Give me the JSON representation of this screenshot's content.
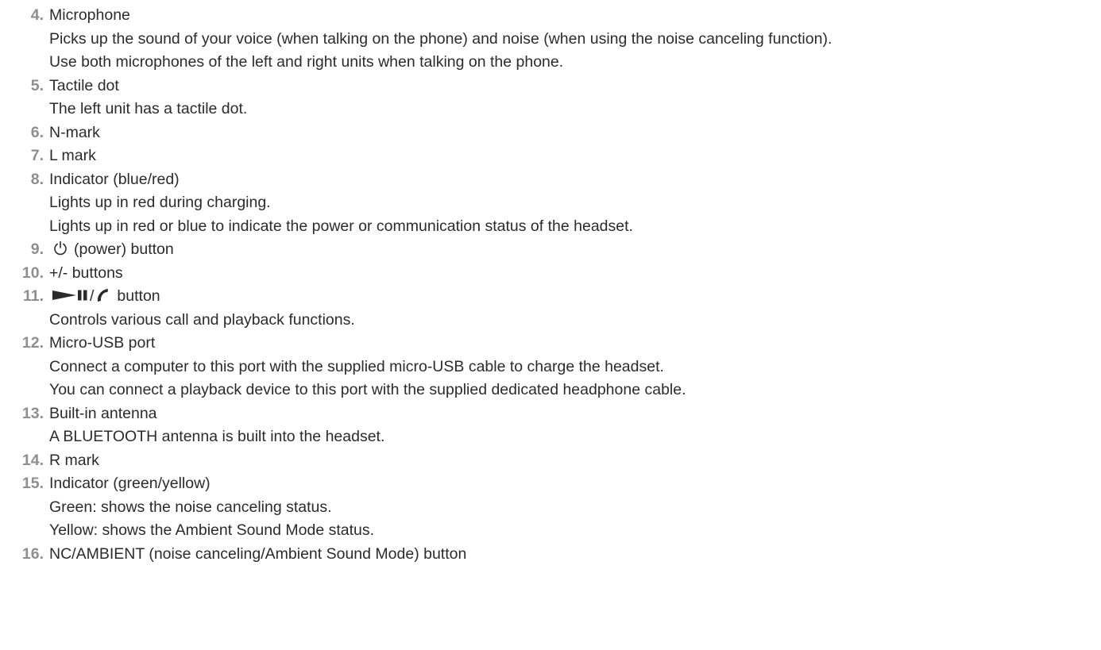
{
  "items": [
    {
      "number": "4.",
      "title": "Microphone",
      "descriptions": [
        "Picks up the sound of your voice (when talking on the phone) and noise (when using the noise canceling function).",
        "Use both microphones of the left and right units when talking on the phone."
      ]
    },
    {
      "number": "5.",
      "title": "Tactile dot",
      "descriptions": [
        "The left unit has a tactile dot."
      ]
    },
    {
      "number": "6.",
      "title": "N-mark",
      "descriptions": []
    },
    {
      "number": "7.",
      "title": "L mark",
      "descriptions": []
    },
    {
      "number": "8.",
      "title": "Indicator (blue/red)",
      "descriptions": [
        "Lights up in red during charging.",
        "Lights up in red or blue to indicate the power or communication status of the headset."
      ]
    },
    {
      "number": "9.",
      "title": "(power) button",
      "icon": "power-icon",
      "descriptions": []
    },
    {
      "number": "10.",
      "title": "+/- buttons",
      "descriptions": []
    },
    {
      "number": "11.",
      "title": "button",
      "icon": "play-pause-call-icon",
      "icon_separator": "/",
      "descriptions": [
        "Controls various call and playback functions."
      ]
    },
    {
      "number": "12.",
      "title": "Micro-USB port",
      "descriptions": [
        "Connect a computer to this port with the supplied micro-USB cable to charge the headset.",
        "You can connect a playback device to this port with the supplied dedicated headphone cable."
      ]
    },
    {
      "number": "13.",
      "title": "Built-in antenna",
      "descriptions": [
        "A BLUETOOTH antenna is built into the headset."
      ]
    },
    {
      "number": "14.",
      "title": "R mark",
      "descriptions": []
    },
    {
      "number": "15.",
      "title": "Indicator (green/yellow)",
      "descriptions": [
        "Green: shows the noise canceling status.",
        "Yellow: shows the Ambient Sound Mode status."
      ]
    },
    {
      "number": "16.",
      "title": "NC/AMBIENT (noise canceling/Ambient Sound Mode) button",
      "descriptions": []
    }
  ],
  "colors": {
    "number": "#8e8e8e",
    "text": "#2b2b2b",
    "background": "#ffffff"
  }
}
